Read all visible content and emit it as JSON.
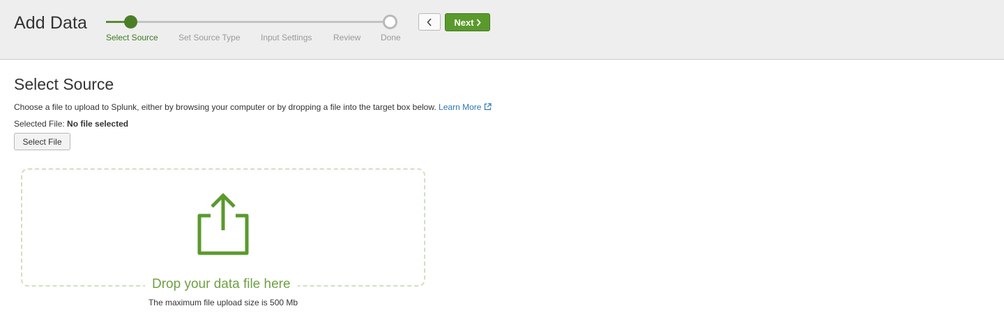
{
  "header": {
    "title": "Add Data",
    "steps": [
      {
        "label": "Select Source",
        "state": "active"
      },
      {
        "label": "Set Source Type",
        "state": "pending"
      },
      {
        "label": "Input Settings",
        "state": "pending"
      },
      {
        "label": "Review",
        "state": "pending"
      },
      {
        "label": "Done",
        "state": "pending"
      }
    ],
    "back_icon": "chevron-left-icon",
    "next_label": "Next",
    "next_icon": "chevron-right-icon"
  },
  "main": {
    "section_title": "Select Source",
    "description": "Choose a file to upload to Splunk, either by browsing your computer or by dropping a file into the target box below.",
    "learn_more": "Learn More",
    "learn_more_icon": "external-link-icon",
    "selected_file_label": "Selected File:",
    "selected_file_value": "No file selected",
    "select_file_button": "Select File",
    "dropzone_icon": "upload-icon",
    "dropzone_label": "Drop your data file here",
    "max_size_note": "The maximum file upload size is 500 Mb"
  },
  "colors": {
    "accent_green": "#5a9a2c",
    "header_bg": "#eeeeee",
    "link_blue": "#2d76b8",
    "dropzone_border": "#cfe0c2"
  }
}
